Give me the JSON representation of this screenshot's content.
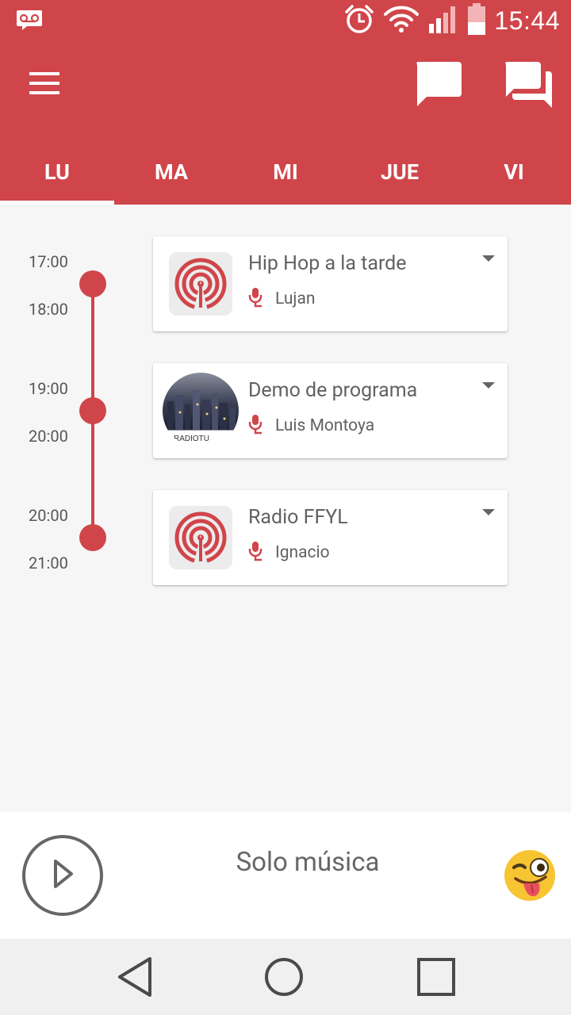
{
  "status_bar": {
    "time": "15:44",
    "icons": [
      "voicemail-icon",
      "alarm-icon",
      "wifi-icon",
      "signal-icon",
      "battery-icon"
    ]
  },
  "app_bar": {
    "icons": [
      "menu-icon",
      "chat-icon",
      "forum-icon"
    ],
    "accent_color": "#d0454a"
  },
  "tabs": [
    {
      "label": "LU",
      "active": true
    },
    {
      "label": "MA",
      "active": false
    },
    {
      "label": "MI",
      "active": false
    },
    {
      "label": "JUE",
      "active": false
    },
    {
      "label": "VI",
      "active": false
    }
  ],
  "schedule": [
    {
      "start": "17:00",
      "end": "18:00",
      "title": "Hip Hop a la tarde",
      "host": "Lujan",
      "thumb": "radio-logo-icon"
    },
    {
      "start": "19:00",
      "end": "20:00",
      "title": "Demo de programa",
      "host": "Luis Montoya",
      "thumb": "city-photo",
      "thumb_text": "RADIOTU"
    },
    {
      "start": "20:00",
      "end": "21:00",
      "title": "Radio FFYL",
      "host": "Ignacio",
      "thumb": "radio-logo-icon"
    }
  ],
  "player": {
    "now_playing": "Solo música",
    "icons": [
      "play-icon",
      "winking-tongue-emoji"
    ]
  },
  "nav_bar": {
    "icons": [
      "back-icon",
      "home-icon",
      "recents-icon"
    ]
  }
}
